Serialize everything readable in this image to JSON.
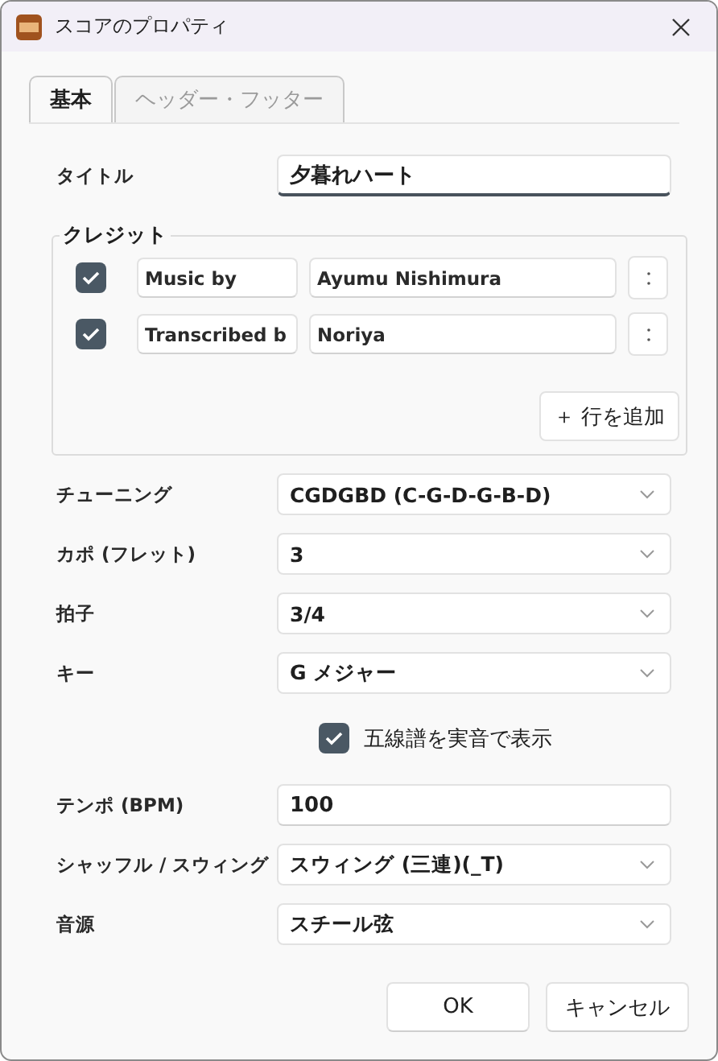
{
  "window": {
    "title": "スコアのプロパティ"
  },
  "tabs": [
    {
      "label": "基本",
      "selected": true
    },
    {
      "label": "ヘッダー・フッター",
      "selected": false
    }
  ],
  "form": [
    {
      "kind": "text",
      "label": "タイトル",
      "value": "夕暮れハート",
      "focused": true
    },
    {
      "kind": "credits",
      "legend": "クレジット",
      "rows": [
        {
          "checked": true,
          "role": "Music by",
          "name": "Ayumu Nishimura"
        },
        {
          "checked": true,
          "role": "Transcribed b",
          "name": "Noriya"
        }
      ],
      "add_button": "＋ 行を追加"
    },
    {
      "kind": "select",
      "label": "チューニング",
      "value": "CGDGBD (C-G-D-G-B-D)"
    },
    {
      "kind": "select",
      "label": "カポ (フレット)",
      "value": "3"
    },
    {
      "kind": "select",
      "label": "拍子",
      "value": "3/4"
    },
    {
      "kind": "select",
      "label": "キー",
      "value": "G メジャー"
    },
    {
      "kind": "checkbox",
      "label": "五線譜を実音で表示",
      "checked": true
    },
    {
      "kind": "text",
      "label": "テンポ (BPM)",
      "value": "100",
      "focused": false
    },
    {
      "kind": "select",
      "label": "シャッフル / スウィング",
      "value": "スウィング (三連)(_T)"
    },
    {
      "kind": "select",
      "label": "音源",
      "value": "スチール弦"
    }
  ],
  "buttons": [
    "OK",
    "キャンセル"
  ]
}
